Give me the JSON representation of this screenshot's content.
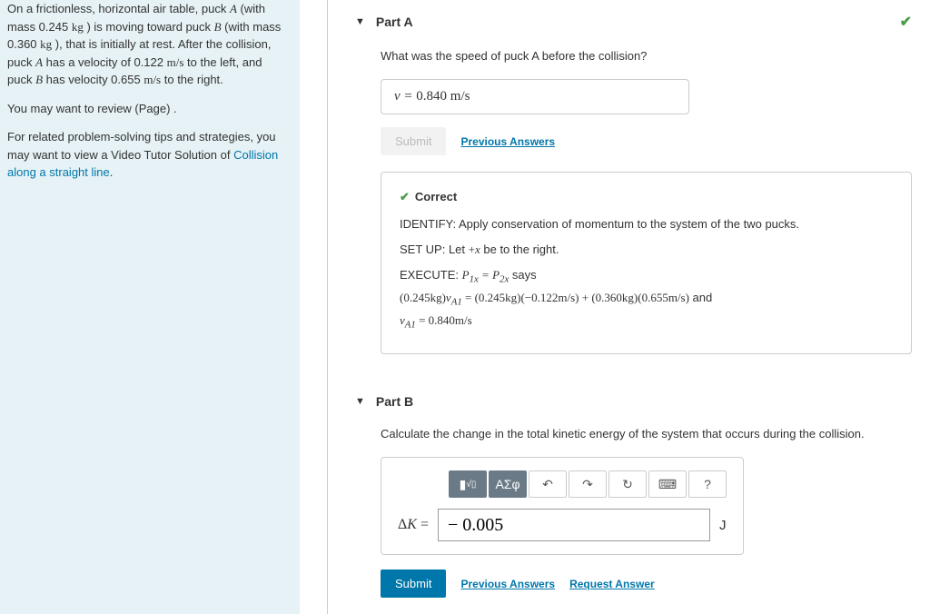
{
  "problem": {
    "para1_a": "On a frictionless, horizontal air table, puck ",
    "para1_b": " (with mass 0.245 ",
    "para1_c": " ) is moving toward puck ",
    "para1_d": " (with mass 0.360 ",
    "para1_e": " ), that is initially at rest. After the collision, puck ",
    "para1_f": " has a velocity of 0.122 ",
    "para1_g": " to the left, and puck ",
    "para1_h": " has velocity 0.655 ",
    "para1_i": " to the right.",
    "puckA": "A",
    "puckB": "B",
    "kg": "kg",
    "ms": "m/s",
    "review": "You may want to review (Page) .",
    "related": "For related problem-solving tips and strategies, you may want to view a Video Tutor Solution of ",
    "link": "Collision along a straight line"
  },
  "partA": {
    "title": "Part A",
    "question": "What was the speed of puck A before the collision?",
    "answer_prefix": "v = ",
    "answer_value": "0.840",
    "answer_unit": " m/s",
    "submit": "Submit",
    "prev": "Previous Answers",
    "correct": "Correct",
    "identify": "IDENTIFY: Apply conservation of momentum to the system of the two pucks.",
    "setup_a": "SET UP: Let ",
    "setup_b": " be to the right.",
    "exec_a": "EXECUTE: ",
    "exec_b": " says",
    "line2_a": "(0.245kg)",
    "line2_b": " = (0.245kg)(−0.122m/s) + (0.360kg)(0.655m/s)",
    "line2_c": " and",
    "line3_b": " = 0.840m/s"
  },
  "partB": {
    "title": "Part B",
    "question": "Calculate the change in the total kinetic energy of the system that occurs during the collision.",
    "input_value": "− 0.005",
    "unit": "J",
    "delta": "ΔK",
    "equals": " = ",
    "submit": "Submit",
    "prev": "Previous Answers",
    "req": "Request Answer",
    "greek": "ΑΣφ",
    "question_mark": "?"
  }
}
